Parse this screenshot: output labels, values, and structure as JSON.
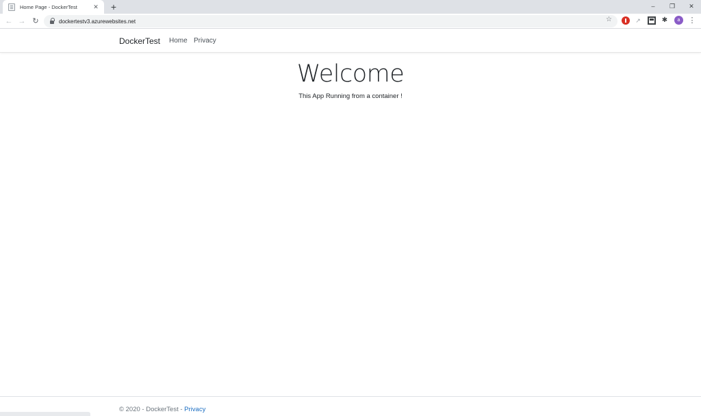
{
  "browser": {
    "tab_title": "Home Page - DockerTest",
    "tab_close": "✕",
    "new_tab": "+",
    "minimize": "–",
    "restore": "❐",
    "close": "✕",
    "back": "←",
    "forward": "→",
    "reload": "↻",
    "url": "dockertestv3.azurewebsites.net",
    "star": "☆",
    "avatar_letter": "a",
    "puzzle": "✱",
    "link_glyph": "↗",
    "menu": "⋮"
  },
  "navbar": {
    "brand": "DockerTest",
    "links": [
      "Home",
      "Privacy"
    ]
  },
  "main": {
    "heading": "Welcome",
    "tagline": "This App Running from a container !"
  },
  "footer": {
    "copyright": "© 2020 - DockerTest - ",
    "link": "Privacy"
  },
  "colors": {
    "accent": "#1b6ec2",
    "tabstrip": "#dee1e6",
    "avatar": "#8a5cc7"
  }
}
